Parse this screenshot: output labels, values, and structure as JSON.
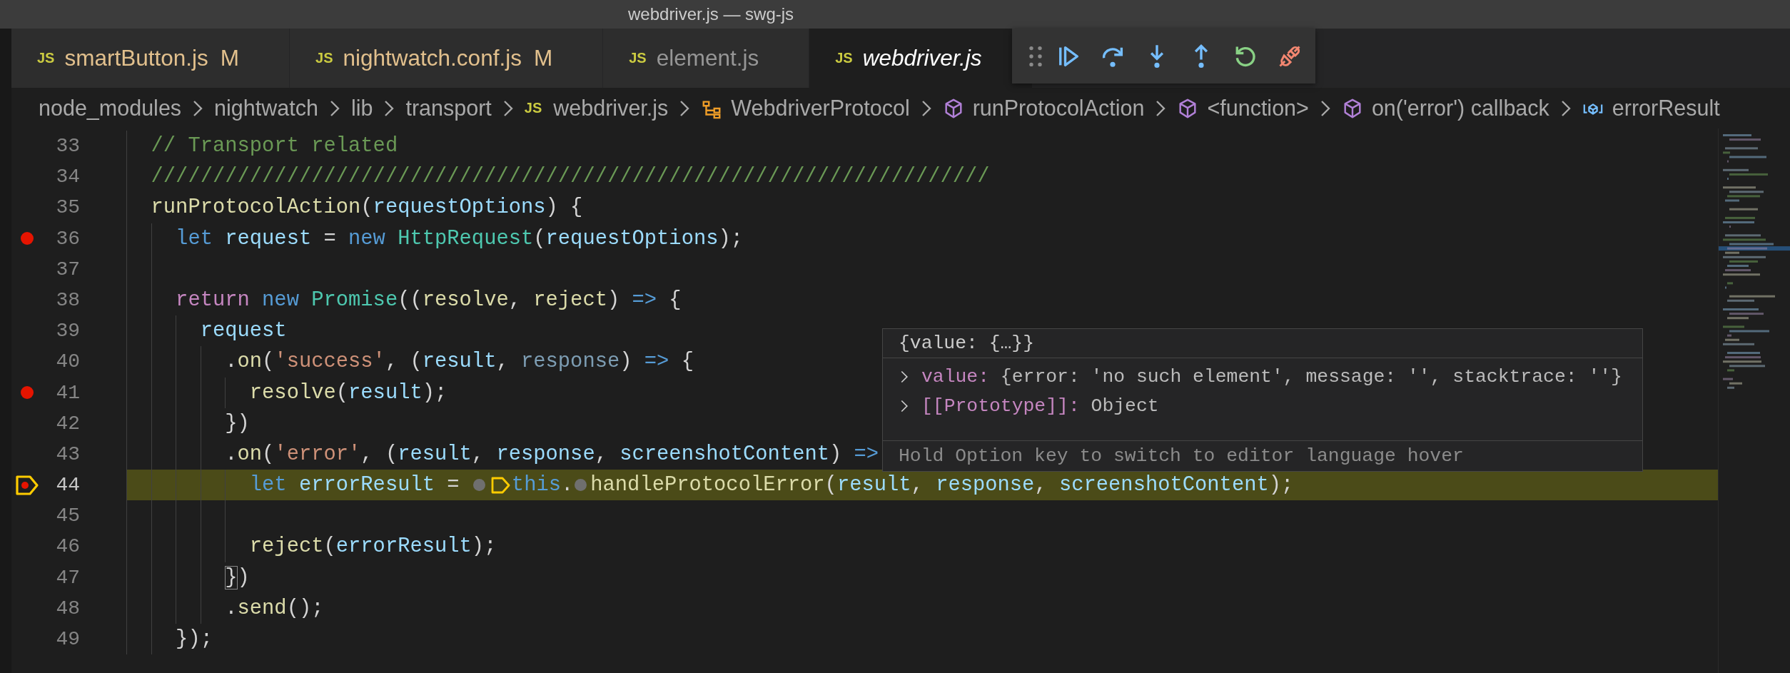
{
  "window": {
    "title": "webdriver.js — swg-js"
  },
  "tabs": [
    {
      "icon_text": "JS",
      "label": "smartButton.js",
      "badge": "M",
      "modified": true,
      "preview": false,
      "selected": false
    },
    {
      "icon_text": "JS",
      "label": "nightwatch.conf.js",
      "badge": "M",
      "modified": true,
      "preview": false,
      "selected": false
    },
    {
      "icon_text": "JS",
      "label": "element.js",
      "modified": false,
      "preview": false,
      "selected": false
    },
    {
      "icon_text": "JS",
      "label": "webdriver.js",
      "modified": false,
      "preview": true,
      "selected": true
    }
  ],
  "debug_toolbar": {
    "buttons": [
      {
        "kind": "continue"
      },
      {
        "kind": "step-over"
      },
      {
        "kind": "step-into"
      },
      {
        "kind": "step-out"
      },
      {
        "kind": "restart"
      },
      {
        "kind": "disconnect"
      }
    ]
  },
  "breadcrumbs": [
    {
      "kind": "folder",
      "label": "node_modules"
    },
    {
      "kind": "folder",
      "label": "nightwatch"
    },
    {
      "kind": "folder",
      "label": "lib"
    },
    {
      "kind": "folder",
      "label": "transport"
    },
    {
      "kind": "file",
      "icon_text": "JS",
      "label": "webdriver.js"
    },
    {
      "kind": "class",
      "label": "WebdriverProtocol"
    },
    {
      "kind": "method",
      "label": "runProtocolAction"
    },
    {
      "kind": "method",
      "label": "<function>"
    },
    {
      "kind": "method",
      "label": "on('error') callback"
    },
    {
      "kind": "variable",
      "label": "errorResult"
    }
  ],
  "editor": {
    "lines": [
      {
        "number": "33",
        "breakpoint": false,
        "current": false,
        "tokens": [
          {
            "text": "  // Transport related",
            "kind": "comment"
          }
        ]
      },
      {
        "number": "34",
        "breakpoint": false,
        "current": false,
        "tokens": [
          {
            "text": "  ////////////////////////////////////////////////////////////////////",
            "kind": "comment"
          }
        ]
      },
      {
        "number": "35",
        "breakpoint": false,
        "current": false,
        "tokens": [
          {
            "text": "  runProtocolAction",
            "kind": "function"
          },
          {
            "text": "(",
            "kind": "punct"
          },
          {
            "text": "requestOptions",
            "kind": "variable"
          },
          {
            "text": ") {",
            "kind": "punct"
          }
        ]
      },
      {
        "number": "36",
        "breakpoint": true,
        "current": false,
        "tokens": [
          {
            "text": "    let",
            "kind": "keyword"
          },
          {
            "text": " request",
            "kind": "variable"
          },
          {
            "text": " = ",
            "kind": "punct"
          },
          {
            "text": "new",
            "kind": "keyword"
          },
          {
            "text": " HttpRequest",
            "kind": "class"
          },
          {
            "text": "(",
            "kind": "punct"
          },
          {
            "text": "requestOptions",
            "kind": "variable"
          },
          {
            "text": ");",
            "kind": "punct"
          }
        ]
      },
      {
        "number": "37",
        "breakpoint": false,
        "current": false
      },
      {
        "number": "38",
        "breakpoint": false,
        "current": false,
        "tokens": [
          {
            "text": "    return",
            "kind": "control"
          },
          {
            "text": " new",
            "kind": "keyword"
          },
          {
            "text": " Promise",
            "kind": "class"
          },
          {
            "text": "((",
            "kind": "punct"
          },
          {
            "text": "resolve",
            "kind": "function"
          },
          {
            "text": ", ",
            "kind": "punct"
          },
          {
            "text": "reject",
            "kind": "function"
          },
          {
            "text": ") ",
            "kind": "punct"
          },
          {
            "text": "=>",
            "kind": "keyword"
          },
          {
            "text": " {",
            "kind": "punct"
          }
        ]
      },
      {
        "number": "39",
        "breakpoint": false,
        "current": false,
        "tokens": [
          {
            "text": "      request",
            "kind": "variable"
          }
        ]
      },
      {
        "number": "40",
        "breakpoint": false,
        "current": false,
        "tokens": [
          {
            "text": "        .",
            "kind": "punct"
          },
          {
            "text": "on",
            "kind": "function"
          },
          {
            "text": "(",
            "kind": "punct"
          },
          {
            "text": "'success'",
            "kind": "string"
          },
          {
            "text": ", (",
            "kind": "punct"
          },
          {
            "text": "result",
            "kind": "variable"
          },
          {
            "text": ", ",
            "kind": "punct"
          },
          {
            "text": "response",
            "kind": "unused"
          },
          {
            "text": ") ",
            "kind": "punct"
          },
          {
            "text": "=>",
            "kind": "keyword"
          },
          {
            "text": " {",
            "kind": "punct"
          }
        ]
      },
      {
        "number": "41",
        "breakpoint": true,
        "current": false,
        "tokens": [
          {
            "text": "          resolve",
            "kind": "function"
          },
          {
            "text": "(",
            "kind": "punct"
          },
          {
            "text": "result",
            "kind": "variable"
          },
          {
            "text": ");",
            "kind": "punct"
          }
        ]
      },
      {
        "number": "42",
        "breakpoint": false,
        "current": false,
        "tokens": [
          {
            "text": "        })",
            "kind": "punct"
          }
        ]
      },
      {
        "number": "43",
        "breakpoint": false,
        "current": false,
        "tokens": [
          {
            "text": "        .",
            "kind": "punct"
          },
          {
            "text": "on",
            "kind": "function"
          },
          {
            "text": "(",
            "kind": "punct"
          },
          {
            "text": "'error'",
            "kind": "string"
          },
          {
            "text": ", (",
            "kind": "punct"
          },
          {
            "text": "result",
            "kind": "variable"
          },
          {
            "text": ", ",
            "kind": "punct"
          },
          {
            "text": "response",
            "kind": "variable"
          },
          {
            "text": ", ",
            "kind": "punct"
          },
          {
            "text": "screenshotContent",
            "kind": "variable"
          },
          {
            "text": ") ",
            "kind": "punct"
          },
          {
            "text": "=>",
            "kind": "keyword"
          }
        ]
      },
      {
        "number": "44",
        "breakpoint": true,
        "current": true,
        "tokens": [
          {
            "text": "          let",
            "kind": "keyword"
          },
          {
            "text": " errorResult",
            "kind": "variable"
          },
          {
            "text": " = ",
            "kind": "punct"
          },
          {
            "kind": "inline-breakpoint"
          },
          {
            "kind": "inline-frame"
          },
          {
            "text": "this",
            "kind": "keyword"
          },
          {
            "text": ".",
            "kind": "punct"
          },
          {
            "kind": "inline-breakpoint"
          },
          {
            "text": "handleProtocolError",
            "kind": "function"
          },
          {
            "text": "(",
            "kind": "punct"
          },
          {
            "text": "result",
            "kind": "variable"
          },
          {
            "text": ", ",
            "kind": "punct"
          },
          {
            "text": "response",
            "kind": "variable"
          },
          {
            "text": ", ",
            "kind": "punct"
          },
          {
            "text": "screenshotContent",
            "kind": "variable"
          },
          {
            "text": ");",
            "kind": "punct"
          }
        ]
      },
      {
        "number": "45",
        "breakpoint": false,
        "current": false
      },
      {
        "number": "46",
        "breakpoint": false,
        "current": false,
        "tokens": [
          {
            "text": "          reject",
            "kind": "function"
          },
          {
            "text": "(",
            "kind": "punct"
          },
          {
            "text": "errorResult",
            "kind": "variable"
          },
          {
            "text": ");",
            "kind": "punct"
          }
        ]
      },
      {
        "number": "47",
        "breakpoint": false,
        "current": false,
        "tokens": [
          {
            "text": "        }",
            "kind": "bracket-match"
          },
          {
            "text": ")",
            "kind": "punct"
          }
        ]
      },
      {
        "number": "48",
        "breakpoint": false,
        "current": false,
        "tokens": [
          {
            "text": "        .",
            "kind": "punct"
          },
          {
            "text": "send",
            "kind": "function"
          },
          {
            "text": "();",
            "kind": "punct"
          }
        ]
      },
      {
        "number": "49",
        "breakpoint": false,
        "current": false,
        "tokens": [
          {
            "text": "    });",
            "kind": "punct"
          }
        ]
      }
    ]
  },
  "hover": {
    "header": "{value: {…}}",
    "rows": [
      {
        "name": "value:",
        "value": "{error: 'no such element', message: '', stacktrace: ''}",
        "expanded": false
      },
      {
        "name": "[[Prototype]]:",
        "value": "Object",
        "expanded": false
      }
    ],
    "hint": "Hold Option key to switch to editor language hover"
  }
}
